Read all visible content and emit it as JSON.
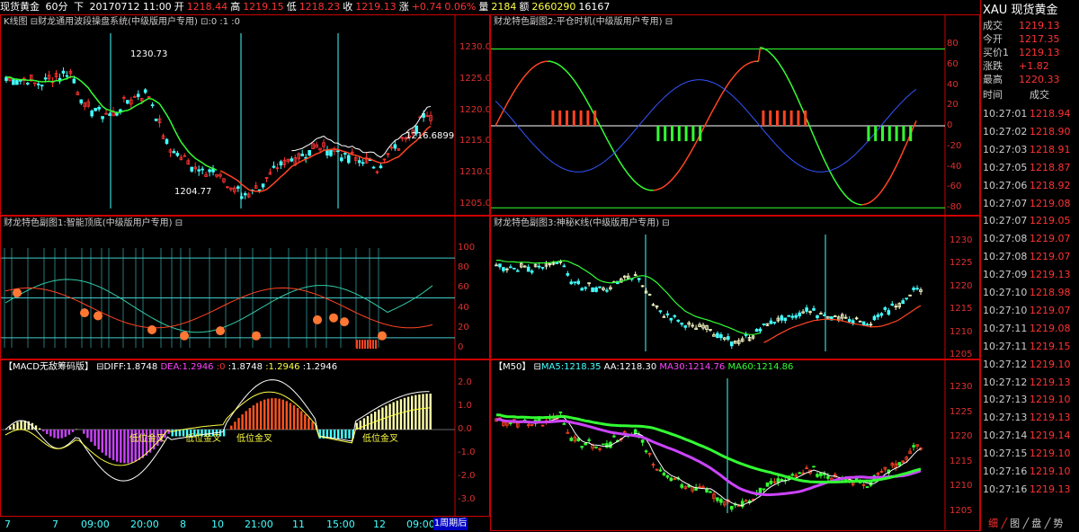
{
  "topbar": {
    "symbol": "现货黄金",
    "period": "60分",
    "dir": "下",
    "datetime": "20170712 11:00",
    "open_label": "开",
    "open": "1218.44",
    "high_label": "高",
    "high": "1219.15",
    "low_label": "低",
    "low": "1218.23",
    "close_label": "收",
    "close": "1219.13",
    "change_label": "涨",
    "change": "+0.74",
    "pct": "0.06%",
    "vol_label": "量",
    "vol": "2184",
    "amt_label": "额",
    "amt": "2660290",
    "extra": "16167"
  },
  "panels": {
    "kline": {
      "title": "K线图 ⊟财龙通用波段操盘系统(中级版用户专用) ⊡:0 :1 :0",
      "ann_high": "1230.73",
      "ann_low": "1204.77",
      "ann_cur": "1216.6899",
      "axis": [
        "1230.0",
        "1225.0",
        "1220.0",
        "1215.0",
        "1210.0",
        "1205.0"
      ]
    },
    "sub2": {
      "title": "财龙特色副图2:平仓时机(中级版用户专用) ⊟",
      "axis": [
        "80",
        "60",
        "40",
        "20",
        "0",
        "-20",
        "-40",
        "-60",
        "-80"
      ]
    },
    "sub1": {
      "title": "财龙特色副图1:智能顶底(中级版用户专用) ⊟",
      "axis": [
        "100",
        "80",
        "60",
        "40",
        "20",
        "0"
      ]
    },
    "sub3": {
      "title": "财龙特色副图3:神秘K线(中级版用户专用) ⊟",
      "axis": [
        "1230",
        "1225",
        "1220",
        "1215",
        "1210",
        "1205"
      ]
    },
    "macd": {
      "title_a": "【MACD无敌筹码版】 ⊟",
      "diff": "DIFF:1.8748",
      "dea": "DEA:1.2946",
      "z": ":0",
      "v1": ":1.8748",
      "v2": ":1.2946",
      "v3": ":1.2946",
      "axis": [
        "2.0",
        "1.0",
        "0.0",
        "-1.0",
        "-2.0",
        "-3.0"
      ],
      "ann1": "低位金叉",
      "ann2": "低位金叉",
      "ann3": "低位金叉",
      "ann4": "低位金叉"
    },
    "ma": {
      "title_a": "【M50】 ⊟",
      "ma5": "MA5:1218.35",
      "aa": "AA:1218.30",
      "ma30": "MA30:1214.76",
      "ma60": "MA60:1214.86",
      "axis": [
        "1230",
        "1225",
        "1220",
        "1215",
        "1210",
        "1205"
      ]
    }
  },
  "xaxis": [
    "7",
    "7",
    "09:00",
    "20:00",
    "8",
    "10",
    "21:00",
    "11",
    "15:00",
    "12",
    "09:00"
  ],
  "period_button": "1周期后",
  "right": {
    "title": "XAU  现货黄金",
    "quotes": [
      {
        "label": "成交",
        "value": "1219.13"
      },
      {
        "label": "今开",
        "value": "1217.35"
      },
      {
        "label": "买价1",
        "value": "1219.13"
      },
      {
        "label": "涨跌",
        "value": "+1.82"
      },
      {
        "label": "最高",
        "value": "1220.33"
      }
    ],
    "header_time": "时间",
    "header_price": "成交",
    "ticks": [
      {
        "t": "10:27:01",
        "p": "1218.94"
      },
      {
        "t": "10:27:02",
        "p": "1218.90"
      },
      {
        "t": "10:27:03",
        "p": "1218.91"
      },
      {
        "t": "10:27:05",
        "p": "1218.87"
      },
      {
        "t": "10:27:06",
        "p": "1218.92"
      },
      {
        "t": "10:27:07",
        "p": "1219.08"
      },
      {
        "t": "10:27:07",
        "p": "1219.05"
      },
      {
        "t": "10:27:08",
        "p": "1219.07"
      },
      {
        "t": "10:27:08",
        "p": "1219.07"
      },
      {
        "t": "10:27:09",
        "p": "1219.13"
      },
      {
        "t": "10:27:10",
        "p": "1218.98"
      },
      {
        "t": "10:27:10",
        "p": "1219.07"
      },
      {
        "t": "10:27:11",
        "p": "1219.08"
      },
      {
        "t": "10:27:11",
        "p": "1219.15"
      },
      {
        "t": "10:27:12",
        "p": "1219.10"
      },
      {
        "t": "10:27:12",
        "p": "1219.13"
      },
      {
        "t": "10:27:13",
        "p": "1219.10"
      },
      {
        "t": "10:27:13",
        "p": "1219.13"
      },
      {
        "t": "10:27:14",
        "p": "1219.14"
      },
      {
        "t": "10:27:15",
        "p": "1219.10"
      },
      {
        "t": "10:27:16",
        "p": "1219.10"
      },
      {
        "t": "10:27:16",
        "p": "1219.13"
      }
    ],
    "tabs": [
      "细",
      "图",
      "盘",
      "势"
    ]
  }
}
